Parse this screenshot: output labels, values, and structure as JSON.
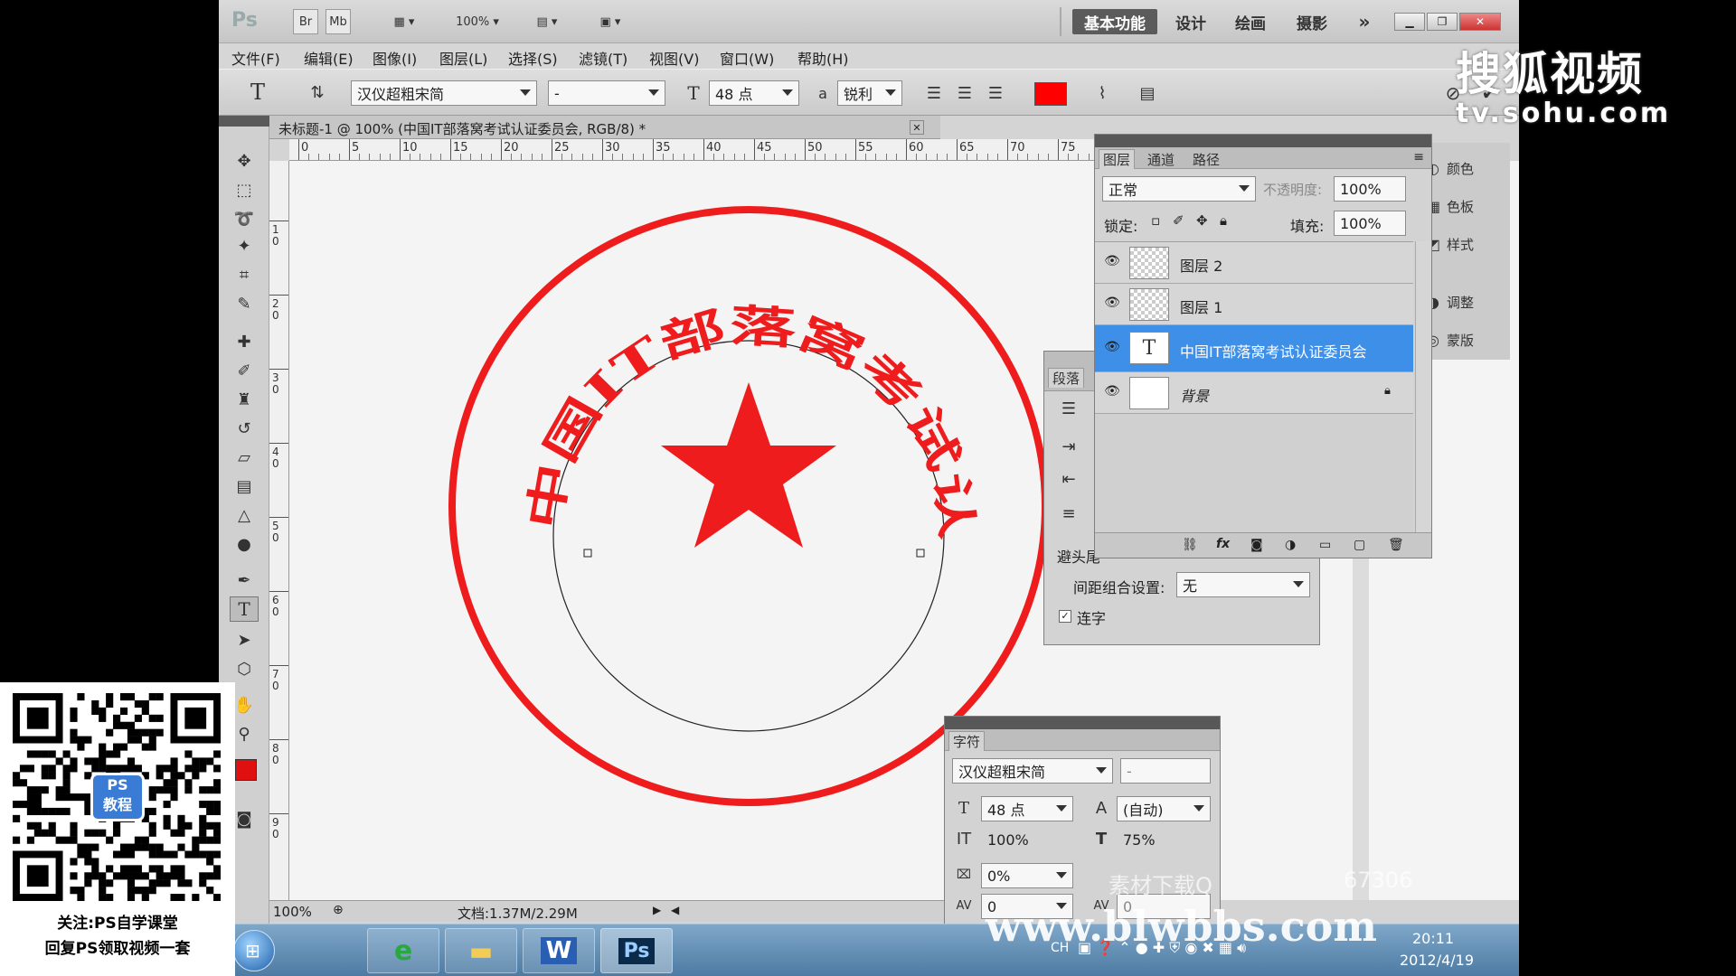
{
  "app": {
    "logo": "Ps"
  },
  "appbar": {
    "launch_br": "Br",
    "launch_mb": "Mb",
    "zoom": "100%",
    "workspaces": [
      "基本功能",
      "设计",
      "绘画",
      "摄影"
    ],
    "more": "»"
  },
  "menus": [
    "文件(F)",
    "编辑(E)",
    "图像(I)",
    "图层(L)",
    "选择(S)",
    "滤镜(T)",
    "视图(V)",
    "窗口(W)",
    "帮助(H)"
  ],
  "options": {
    "font_family": "汉仪超粗宋简",
    "font_style": "-",
    "font_size": "48 点",
    "aa_label": "a",
    "antialias": "锐利",
    "text_color": "#ff0000"
  },
  "document": {
    "tab_title": "未标题-1 @ 100% (中国IT部落窝考试认证委员会, RGB/8) *",
    "ruler_h": [
      "0",
      "5",
      "10",
      "15",
      "20",
      "25",
      "30",
      "35",
      "40",
      "45",
      "50",
      "55",
      "60",
      "65",
      "70",
      "75"
    ],
    "ruler_v": [
      "1\n0",
      "2\n0",
      "3\n0",
      "4\n0",
      "5\n0",
      "6\n0",
      "7\n0",
      "8\n0",
      "9\n0"
    ],
    "stamp_text": "中国IT部落窝考试认证委员会",
    "stamp_color": "#ee1c1c"
  },
  "status": {
    "zoom": "100%",
    "doc_info": "文档:1.37M/2.29M"
  },
  "layers_panel": {
    "tabs": [
      "图层",
      "通道",
      "路径"
    ],
    "blend_mode": "正常",
    "opacity_label": "不透明度:",
    "opacity": "100%",
    "lock_label": "锁定:",
    "fill_label": "填充:",
    "fill": "100%",
    "layers": [
      {
        "name": "图层 2",
        "type": "pixel",
        "selected": false
      },
      {
        "name": "图层 1",
        "type": "pixel",
        "selected": false
      },
      {
        "name": "中国IT部落窝考试认证委员会",
        "type": "text",
        "selected": true,
        "thumb_glyph": "T"
      },
      {
        "name": "背景",
        "type": "background",
        "selected": false
      }
    ],
    "footer_fx": "fx"
  },
  "paragraph_panel": {
    "tab": "段落",
    "hyphen_label": "避头尾",
    "spacing_label": "间距组合设置:",
    "spacing_value": "无",
    "hyphenate_label": "连字"
  },
  "dock": [
    "颜色",
    "色板",
    "样式",
    "调整",
    "蒙版"
  ],
  "character_panel": {
    "tab": "字符",
    "font_family": "汉仪超粗宋简",
    "font_style": "-",
    "size": "48 点",
    "leading": "(自动)",
    "vscale": "100%",
    "hscale": "75%",
    "tsume": "0%",
    "tracking": "0",
    "kerning": "0"
  },
  "taskbar": {
    "time": "20:11",
    "date": "2012/4/19",
    "lang": "CH"
  },
  "qr_ad": {
    "badge_line1": "PS",
    "badge_line2": "教程",
    "line1": "关注:PS自学课堂",
    "line2": "回复PS领取视频一套"
  },
  "watermarks": {
    "sohu_cn": "搜狐视频",
    "sohu_url": "tv.sohu.com",
    "site": "www.blwbbs.com",
    "material": "素材下载Q",
    "number": "67306"
  }
}
